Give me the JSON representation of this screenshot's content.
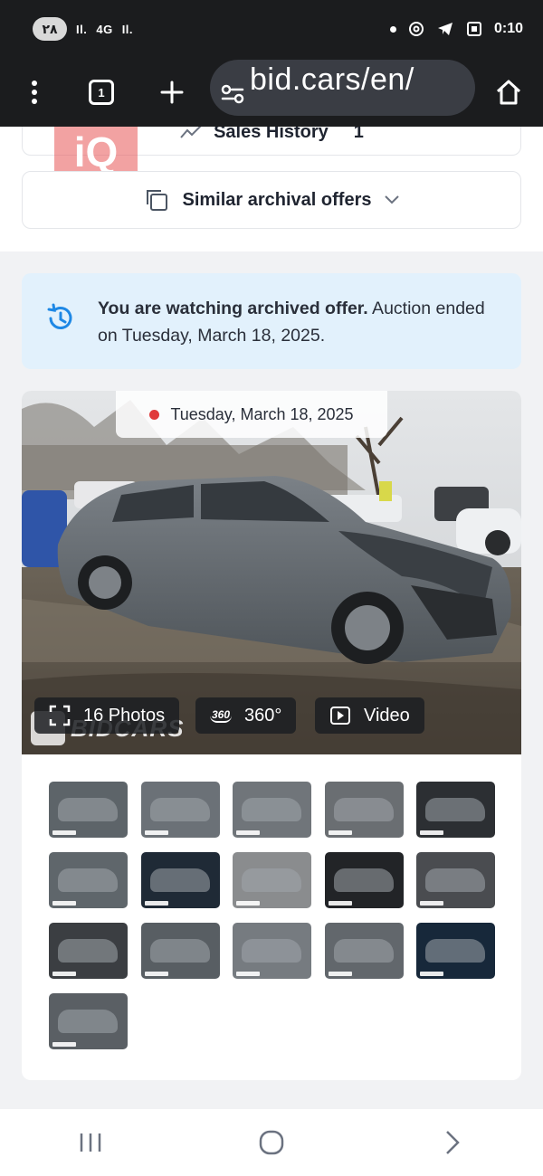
{
  "status_bar": {
    "badge": "٢٨",
    "signal_1": "Il.",
    "signal_2_type": "4G",
    "signal_3": "Il.",
    "time": "0:10",
    "icons": [
      "dot-icon",
      "threads-icon",
      "telegram-icon",
      "screen-capture-icon"
    ]
  },
  "browser": {
    "url": "bid.cars/en/",
    "tab_count": "1",
    "buttons": [
      "menu-icon",
      "tabs-icon",
      "new-tab-icon",
      "site-settings-icon",
      "home-icon"
    ]
  },
  "page": {
    "partial_card_label": "Sales History",
    "partial_card_count": "1",
    "similar_label": "Similar archival offers",
    "overlay_logo": "iQ",
    "notice": {
      "bold": "You are watching archived offer.",
      "text": " Auction ended on Tuesday, March 18, 2025."
    },
    "gallery": {
      "date": "Tuesday, March 18, 2025",
      "photos_label": "16 Photos",
      "view360_badge": "360",
      "view360_label": "360°",
      "video_label": "Video",
      "watermark": "BIDCARS",
      "thumbnails": [
        {
          "name": "thumb-front-left",
          "bg": "#5d6469"
        },
        {
          "name": "thumb-left-side",
          "bg": "#6b7177"
        },
        {
          "name": "thumb-rear-left",
          "bg": "#70757a"
        },
        {
          "name": "thumb-rear-right",
          "bg": "#6a6e72"
        },
        {
          "name": "thumb-interior-dash",
          "bg": "#2c2f33"
        },
        {
          "name": "thumb-front-damage",
          "bg": "#5f666b"
        },
        {
          "name": "thumb-instrument-cluster",
          "bg": "#1f2a36"
        },
        {
          "name": "thumb-rear-seat",
          "bg": "#8a8c8e"
        },
        {
          "name": "thumb-vin-label",
          "bg": "#222427"
        },
        {
          "name": "thumb-stock-sticker",
          "bg": "#4a4c50"
        },
        {
          "name": "thumb-wheel",
          "bg": "#3b3e42"
        },
        {
          "name": "thumb-front-view",
          "bg": "#585e63"
        },
        {
          "name": "thumb-side-view",
          "bg": "#767b80"
        },
        {
          "name": "thumb-rear-view",
          "bg": "#62676c"
        },
        {
          "name": "thumb-odometer",
          "bg": "#17283a"
        },
        {
          "name": "thumb-rear-close",
          "bg": "#5a5f64"
        }
      ]
    }
  },
  "nav": {
    "buttons": [
      "recents-icon",
      "home-circle-icon",
      "back-icon"
    ]
  },
  "colors": {
    "accent_blue": "#1e88e5",
    "notice_bg": "#e2f1fc",
    "status_bar_bg": "#1b1c1e"
  }
}
